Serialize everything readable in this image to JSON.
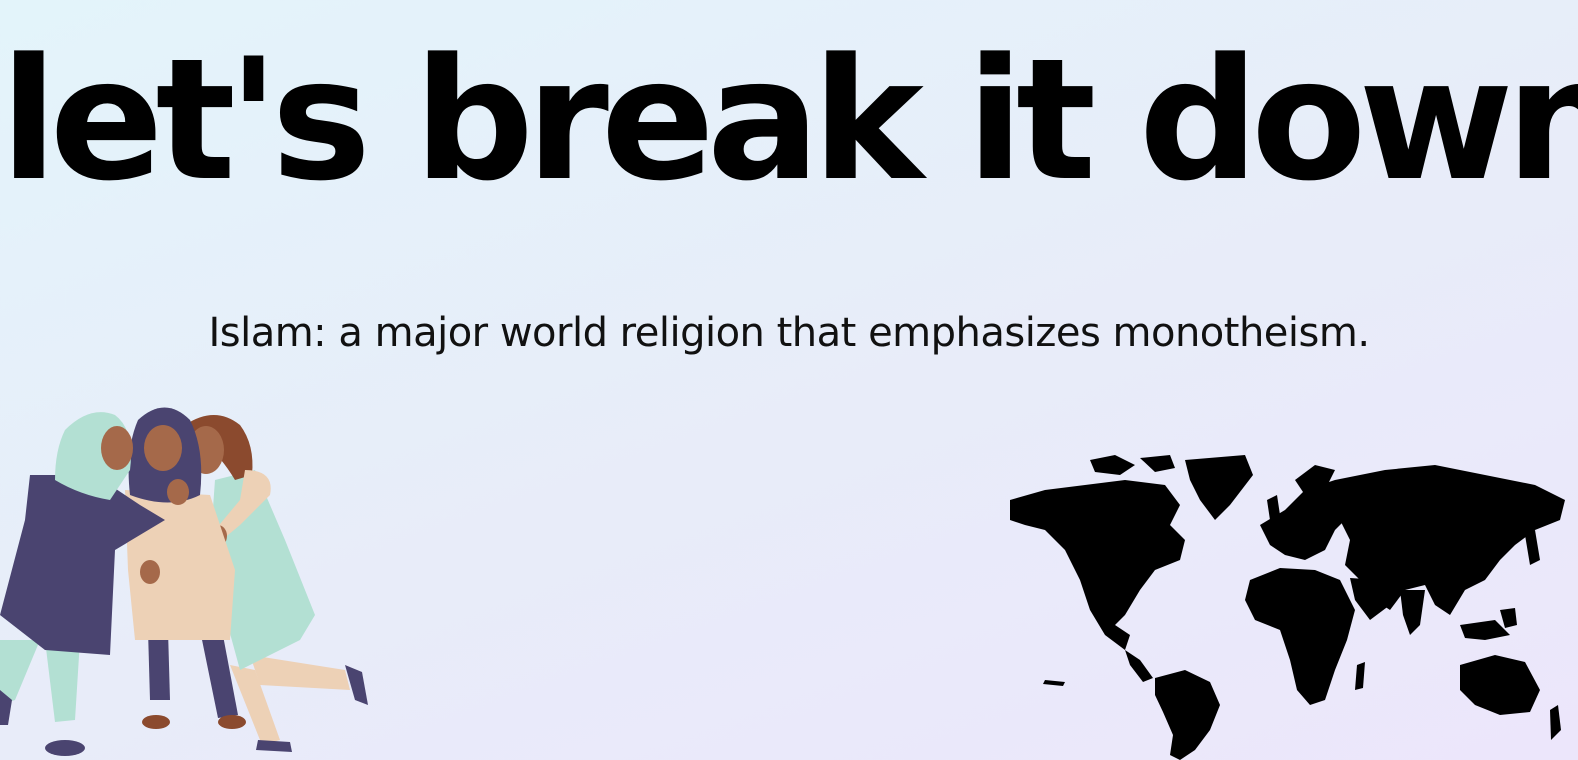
{
  "slide": {
    "title": "let's break it down",
    "subtitle": "Islam: a major world religion that emphasizes monotheism."
  },
  "illustrations": {
    "people_icon": "three-women-hugging-illustration",
    "map_icon": "world-map-silhouette"
  },
  "colors": {
    "background_start": "#e3f4fa",
    "background_end": "#ece6fb",
    "text": "#000000",
    "navy": "#4a4470",
    "mint": "#b3e0d3",
    "cream": "#edd1b6",
    "skin": "#a5694a",
    "brown_hair": "#8b4a2e"
  }
}
